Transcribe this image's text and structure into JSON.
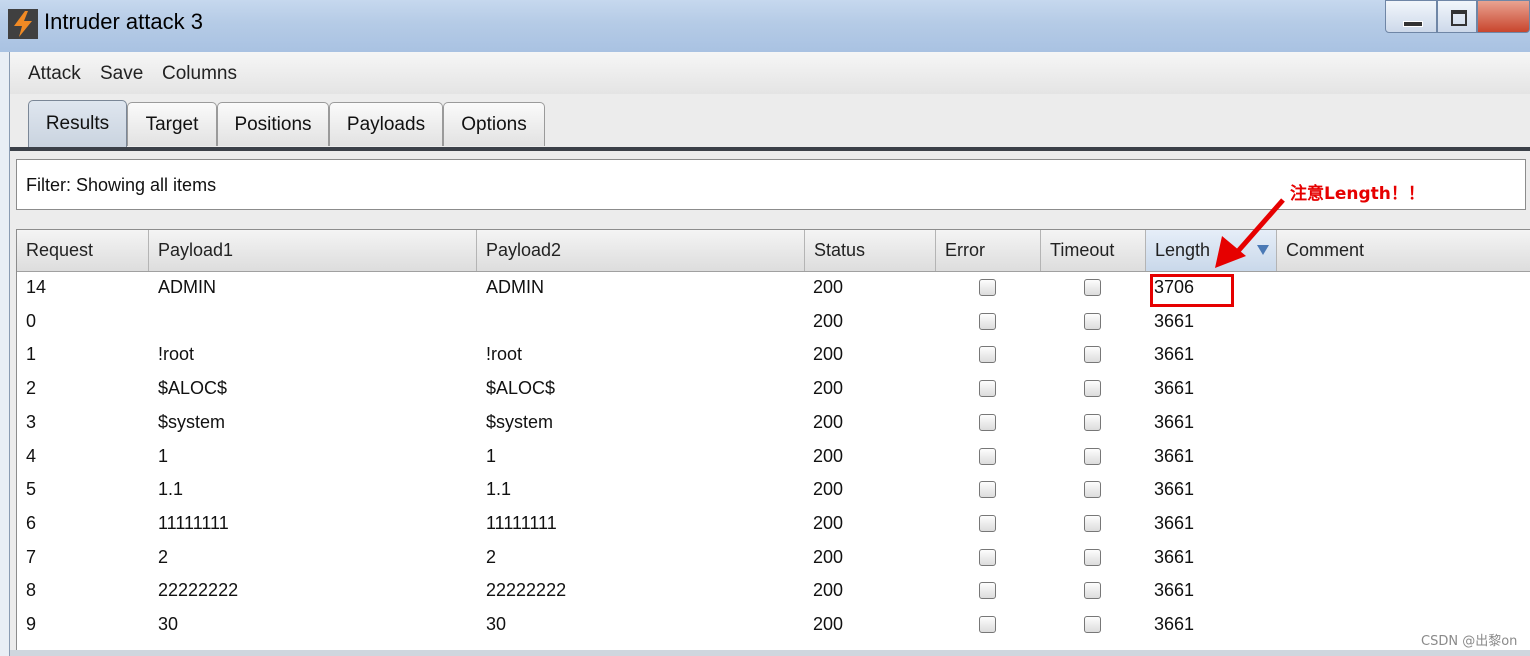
{
  "window": {
    "title": "Intruder attack 3"
  },
  "menu": [
    "Attack",
    "Save",
    "Columns"
  ],
  "tabs": [
    "Results",
    "Target",
    "Positions",
    "Payloads",
    "Options"
  ],
  "active_tab": "Results",
  "filter": {
    "text": "Filter:  Showing all items"
  },
  "table": {
    "columns": [
      "Request",
      "Payload1",
      "Payload2",
      "Status",
      "Error",
      "Timeout",
      "Length",
      "Comment"
    ],
    "sorted_column": "Length",
    "rows": [
      {
        "request": "14",
        "payload1": "ADMIN",
        "payload2": "ADMIN",
        "status": "200",
        "error": false,
        "timeout": false,
        "length": "3706",
        "comment": ""
      },
      {
        "request": "0",
        "payload1": "",
        "payload2": "",
        "status": "200",
        "error": false,
        "timeout": false,
        "length": "3661",
        "comment": ""
      },
      {
        "request": "1",
        "payload1": "!root",
        "payload2": "!root",
        "status": "200",
        "error": false,
        "timeout": false,
        "length": "3661",
        "comment": ""
      },
      {
        "request": "2",
        "payload1": "$ALOC$",
        "payload2": "$ALOC$",
        "status": "200",
        "error": false,
        "timeout": false,
        "length": "3661",
        "comment": ""
      },
      {
        "request": "3",
        "payload1": "$system",
        "payload2": "$system",
        "status": "200",
        "error": false,
        "timeout": false,
        "length": "3661",
        "comment": ""
      },
      {
        "request": "4",
        "payload1": "1",
        "payload2": "1",
        "status": "200",
        "error": false,
        "timeout": false,
        "length": "3661",
        "comment": ""
      },
      {
        "request": "5",
        "payload1": "1.1",
        "payload2": "1.1",
        "status": "200",
        "error": false,
        "timeout": false,
        "length": "3661",
        "comment": ""
      },
      {
        "request": "6",
        "payload1": "11111111",
        "payload2": "11111111",
        "status": "200",
        "error": false,
        "timeout": false,
        "length": "3661",
        "comment": ""
      },
      {
        "request": "7",
        "payload1": "2",
        "payload2": "2",
        "status": "200",
        "error": false,
        "timeout": false,
        "length": "3661",
        "comment": ""
      },
      {
        "request": "8",
        "payload1": "22222222",
        "payload2": "22222222",
        "status": "200",
        "error": false,
        "timeout": false,
        "length": "3661",
        "comment": ""
      },
      {
        "request": "9",
        "payload1": "30",
        "payload2": "30",
        "status": "200",
        "error": false,
        "timeout": false,
        "length": "3661",
        "comment": ""
      }
    ]
  },
  "annotation": {
    "text": "注意Length！！",
    "color": "#e60000"
  },
  "watermark": "CSDN @出黎on",
  "icons": {
    "app": "burp-lightning-icon",
    "minimize": "minimize-icon",
    "maximize": "maximize-icon",
    "close": "close-icon",
    "sort": "sort-descending-icon"
  }
}
